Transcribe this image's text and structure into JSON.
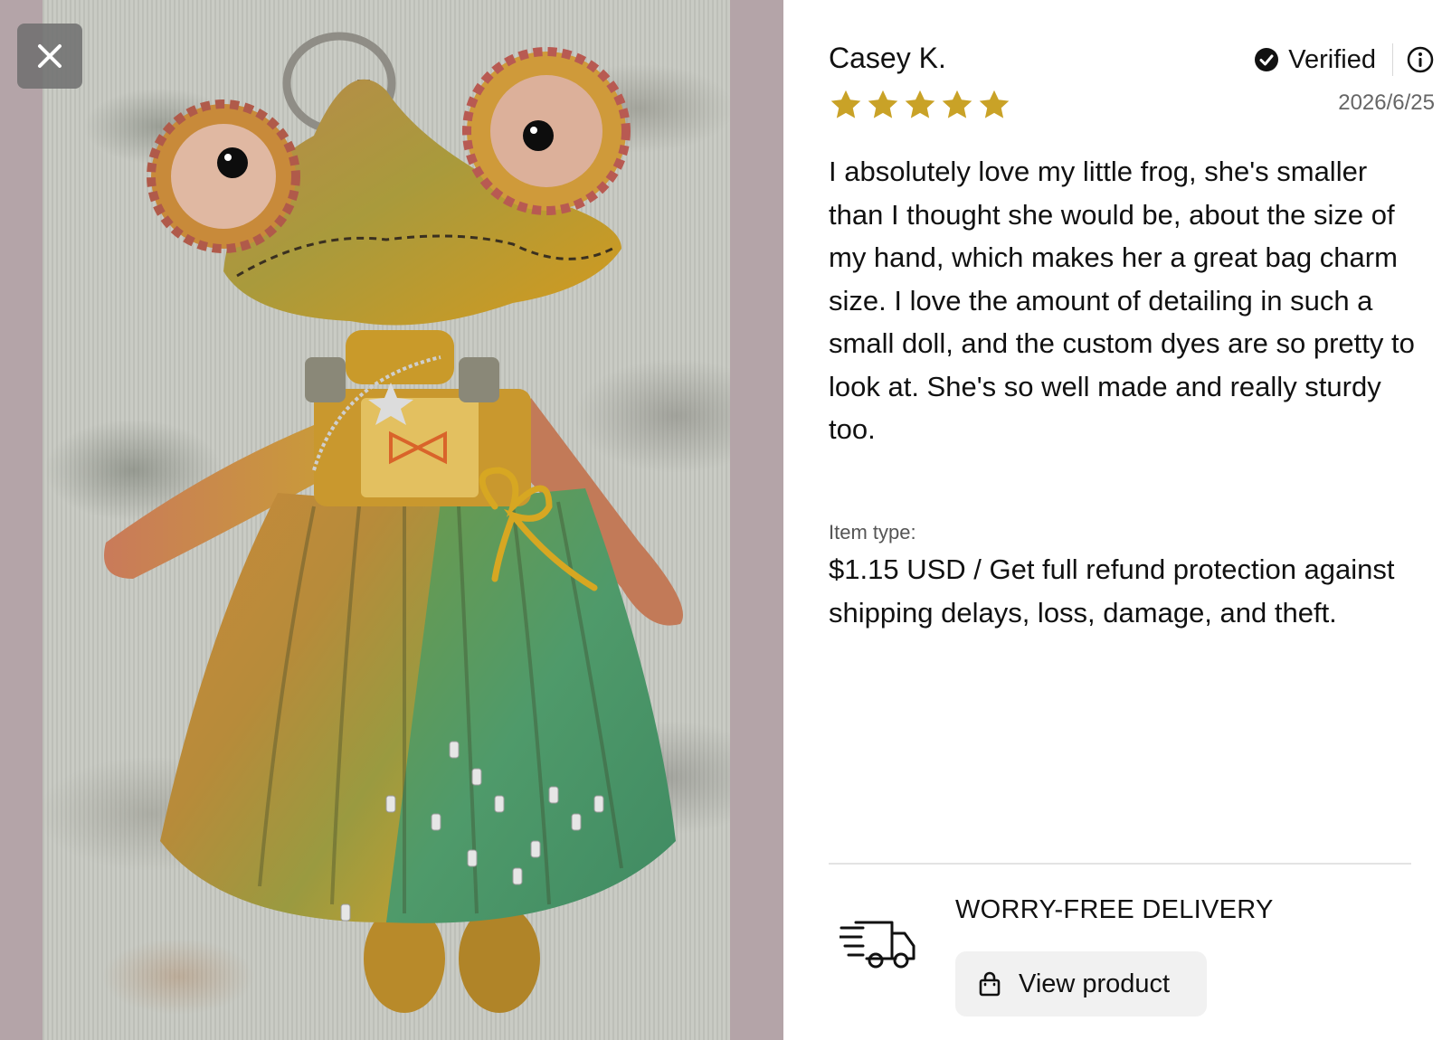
{
  "review": {
    "reviewer_name": "Casey K.",
    "verified_label": "Verified",
    "rating": 5,
    "rating_max": 5,
    "date": "2026/6/25",
    "body": "I absolutely love my little frog, she's smaller than I thought she would be, about the size of my hand, which makes her a great bag charm size. I love the amount of detailing in such a small doll, and the custom dyes are so pretty to look at. She's so well made and really sturdy too.",
    "item_type_label": "Item type:",
    "item_type_value": "$1.15 USD / Get full refund protection against shipping delays, loss, damage, and theft."
  },
  "delivery": {
    "title": "WORRY-FREE DELIVERY",
    "view_product_label": "View product"
  },
  "icons": {
    "close": "close-icon",
    "verified": "check-circle-icon",
    "info": "info-icon",
    "star": "star-icon",
    "truck": "delivery-truck-icon",
    "bag": "shopping-bag-icon"
  },
  "colors": {
    "star": "#c9a227",
    "media_backdrop": "#b4a4a8",
    "button_bg": "#f1f1f1",
    "text": "#111111",
    "muted": "#666666"
  }
}
